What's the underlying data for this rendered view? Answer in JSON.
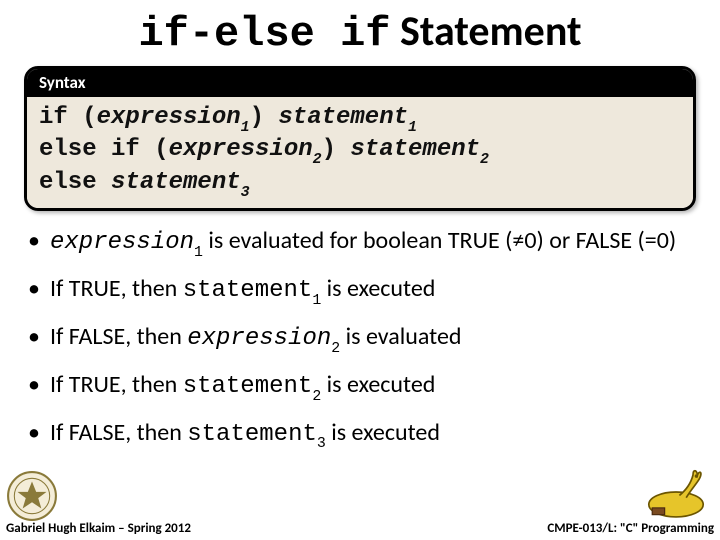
{
  "title": {
    "code": "if-else if",
    "word": " Statement"
  },
  "syntax": {
    "header": "Syntax",
    "lines": [
      {
        "pre": "if (",
        "expr": "expression",
        "sub": "1",
        "mid": ") ",
        "stmt": "statement",
        "ssub": "1",
        "post": ""
      },
      {
        "pre": "else if (",
        "expr": "expression",
        "sub": "2",
        "mid": ") ",
        "stmt": "statement",
        "ssub": "2",
        "post": ""
      },
      {
        "pre": "else ",
        "expr": "",
        "sub": "",
        "mid": "",
        "stmt": "statement",
        "ssub": "3",
        "post": ""
      }
    ]
  },
  "bullets": [
    {
      "a": "",
      "code1": "expression",
      "s1": "1",
      "b": " is evaluated for boolean TRUE (≠0) or FALSE (=0)",
      "code2": "",
      "s2": "",
      "c": ""
    },
    {
      "a": "If TRUE, then ",
      "code1": "statement",
      "s1": "1",
      "b": " is executed",
      "code2": "",
      "s2": "",
      "c": ""
    },
    {
      "a": "If FALSE, then ",
      "code1": "expression",
      "s1": "2",
      "b": " is evaluated",
      "code2": "",
      "s2": "",
      "c": ""
    },
    {
      "a": "If TRUE, then ",
      "code1": "statement",
      "s1": "2",
      "b": " is executed",
      "code2": "",
      "s2": "",
      "c": ""
    },
    {
      "a": "If FALSE, then ",
      "code1": "statement",
      "s1": "3",
      "b": " is executed",
      "code2": "",
      "s2": "",
      "c": ""
    }
  ],
  "footer": {
    "left": "Gabriel Hugh Elkaim – Spring 2012",
    "right": "CMPE-013/L: \"C\" Programming"
  }
}
